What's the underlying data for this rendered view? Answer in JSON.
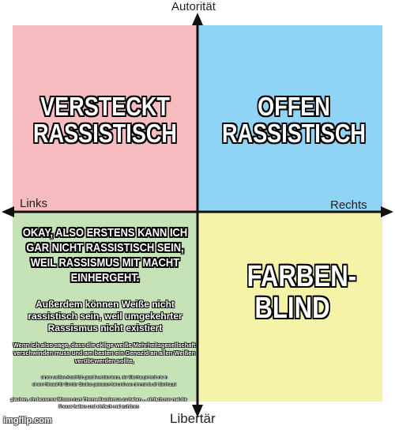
{
  "axes": {
    "top": "Autorität",
    "bottom": "Libertär",
    "left": "Links",
    "right": "Rechts"
  },
  "colors": {
    "top_left": "#f6bcbf",
    "top_right": "#8fd3f5",
    "bottom_left": "#c6e3b8",
    "bottom_right": "#f4f3a7",
    "axis": "#111111"
  },
  "quadrants": {
    "top_left": {
      "caption": "VERSTECKT RASSISTISCH"
    },
    "top_right": {
      "caption": "OFFEN RASSISTISCH"
    },
    "bottom_right": {
      "caption": "FARBEN-BLIND"
    },
    "bottom_left": {
      "caption": "OKAY, ALSO ERSTENS KANN ICH GAR NICHT RASSISTISCH SEIN, WEIL RASSISMUS MIT MACHT EINHERGEHT.",
      "text_2": "Außerdem können Weiße nicht rassistisch sein, weil umgekehrter Rassismus nicht existiert",
      "text_3": "Wenn ich also sage, dass die eklige weiße Mehrheitsgesellschaft verschwinden muss und am besten ein Genozid an allen Weißen verübt werden sollte,",
      "text_4a": "einem weißen Anschlich gezeilt werden kann, der Überhaupt noch nie in",
      "text_4b": "einem Hörsaal für Gender Studies gesessen hat und was nimmst du dir überhaupt",
      "text_5": "glauben, ein besseres Wissen zum Thema Rassismus zu haben ... einfach nur mal die Fresse halten und einfach mal zuhören"
    }
  },
  "watermark": "imgflip.com"
}
